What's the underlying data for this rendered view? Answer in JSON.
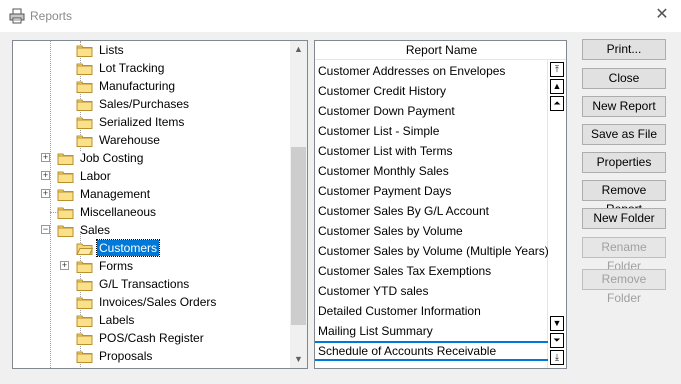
{
  "window": {
    "title": "Reports",
    "close_glyph": "✕"
  },
  "tree": {
    "items": [
      {
        "label": "Lists",
        "level": 2,
        "expander": "",
        "selected": false
      },
      {
        "label": "Lot Tracking",
        "level": 2,
        "expander": "",
        "selected": false
      },
      {
        "label": "Manufacturing",
        "level": 2,
        "expander": "",
        "selected": false
      },
      {
        "label": "Sales/Purchases",
        "level": 2,
        "expander": "",
        "selected": false
      },
      {
        "label": "Serialized Items",
        "level": 2,
        "expander": "",
        "selected": false
      },
      {
        "label": "Warehouse",
        "level": 2,
        "expander": "",
        "selected": false
      },
      {
        "label": "Job Costing",
        "level": 1,
        "expander": "+",
        "selected": false
      },
      {
        "label": "Labor",
        "level": 1,
        "expander": "+",
        "selected": false
      },
      {
        "label": "Management",
        "level": 1,
        "expander": "+",
        "selected": false
      },
      {
        "label": "Miscellaneous",
        "level": 1,
        "expander": "",
        "selected": false
      },
      {
        "label": "Sales",
        "level": 1,
        "expander": "−",
        "selected": false
      },
      {
        "label": "Customers",
        "level": 2,
        "expander": "",
        "selected": true
      },
      {
        "label": "Forms",
        "level": 2,
        "expander": "+",
        "selected": false
      },
      {
        "label": "G/L Transactions",
        "level": 2,
        "expander": "",
        "selected": false
      },
      {
        "label": "Invoices/Sales Orders",
        "level": 2,
        "expander": "",
        "selected": false
      },
      {
        "label": "Labels",
        "level": 2,
        "expander": "",
        "selected": false
      },
      {
        "label": "POS/Cash Register",
        "level": 2,
        "expander": "",
        "selected": false
      },
      {
        "label": "Proposals",
        "level": 2,
        "expander": "",
        "selected": false
      }
    ]
  },
  "reports": {
    "header": "Report Name",
    "items": [
      "Customer Addresses on Envelopes",
      "Customer Credit History",
      "Customer Down Payment",
      "Customer List - Simple",
      "Customer List with Terms",
      "Customer Monthly Sales",
      "Customer Payment Days",
      "Customer Sales By G/L Account",
      "Customer Sales by Volume",
      "Customer Sales by Volume (Multiple Years)",
      "Customer Sales Tax Exemptions",
      "Customer YTD sales",
      "Detailed Customer Information",
      "Mailing List Summary",
      "Schedule of Accounts Receivable"
    ],
    "focused_index": 14
  },
  "buttons": [
    {
      "label": "Print...",
      "enabled": true
    },
    {
      "label": "Close",
      "enabled": true
    },
    {
      "label": "New Report",
      "enabled": true
    },
    {
      "label": "Save as File",
      "enabled": true
    },
    {
      "label": "Properties",
      "enabled": true
    },
    {
      "label": "Remove Report",
      "enabled": true
    },
    {
      "label": "New Folder",
      "enabled": true
    },
    {
      "label": "Rename Folder",
      "enabled": false
    },
    {
      "label": "Remove Folder",
      "enabled": false
    }
  ],
  "colors": {
    "selection": "#0078d7",
    "folder_fill": "#f8d775",
    "folder_edge": "#b89030"
  }
}
